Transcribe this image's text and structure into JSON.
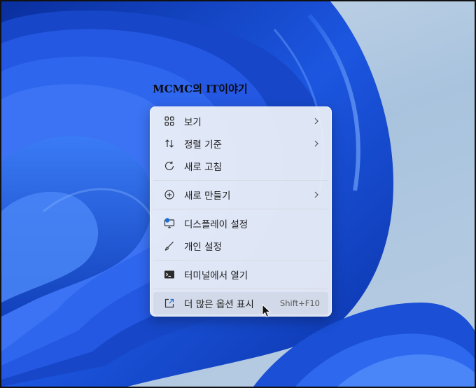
{
  "watermark": {
    "text": "MCMC의 IT이야기"
  },
  "menu": {
    "items": [
      {
        "id": "view",
        "label": "보기",
        "icon": "grid-view-icon",
        "submenu": true
      },
      {
        "id": "sort",
        "label": "정렬 기준",
        "icon": "sort-arrows-icon",
        "submenu": true
      },
      {
        "id": "refresh",
        "label": "새로 고침",
        "icon": "refresh-icon",
        "submenu": false
      },
      {
        "id": "new",
        "label": "새로 만들기",
        "icon": "add-circle-icon",
        "submenu": true
      },
      {
        "id": "display",
        "label": "디스플레이 설정",
        "icon": "monitor-settings-icon",
        "submenu": false
      },
      {
        "id": "personalize",
        "label": "개인 설정",
        "icon": "brush-icon",
        "submenu": false
      },
      {
        "id": "terminal",
        "label": "터미널에서 열기",
        "icon": "terminal-icon",
        "submenu": false
      },
      {
        "id": "more",
        "label": "더 많은 옵션 표시",
        "icon": "expand-options-icon",
        "shortcut": "Shift+F10"
      }
    ]
  },
  "colors": {
    "wallpaper_blue": "#1a4fd6",
    "wallpaper_light": "#c9d9ea",
    "accent": "#1f6fd0"
  }
}
